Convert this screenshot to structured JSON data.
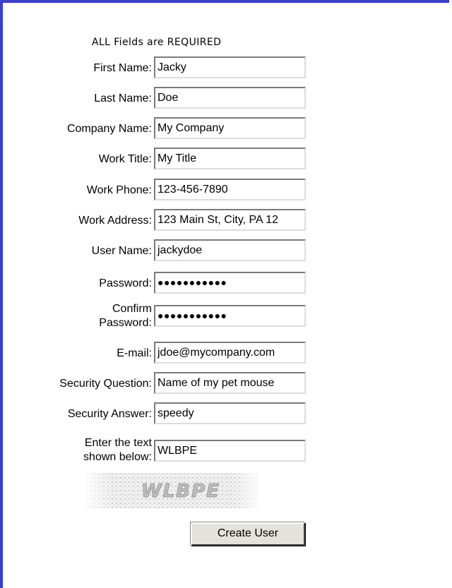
{
  "form": {
    "required_note": "ALL Fields are REQUIRED",
    "fields": [
      {
        "label": "First Name:",
        "value": "Jacky"
      },
      {
        "label": "Last Name:",
        "value": "Doe"
      },
      {
        "label": "Company Name:",
        "value": "My Company"
      },
      {
        "label": "Work Title:",
        "value": "My Title"
      },
      {
        "label": "Work Phone:",
        "value": "123-456-7890"
      },
      {
        "label": "Work Address:",
        "value": "123 Main St, City, PA 12"
      },
      {
        "label": "User Name:",
        "value": "jackydoe"
      },
      {
        "label": "Password:",
        "value": "●●●●●●●●●●●"
      },
      {
        "label_line1": "Confirm",
        "label_line2": "Password:",
        "value": "●●●●●●●●●●●"
      },
      {
        "label": "E-mail:",
        "value": "jdoe@mycompany.com"
      },
      {
        "label": "Security Question:",
        "value": "Name of my pet mouse"
      },
      {
        "label": "Security Answer:",
        "value": "speedy"
      },
      {
        "label_line1": "Enter the text",
        "label_line2": "shown below:",
        "value": "WLBPE"
      }
    ],
    "captcha_text": "WLBPE",
    "submit_label": "Create User"
  },
  "colors": {
    "frame_border": "#3b3fc9",
    "button_face": "#e4e2dc"
  }
}
